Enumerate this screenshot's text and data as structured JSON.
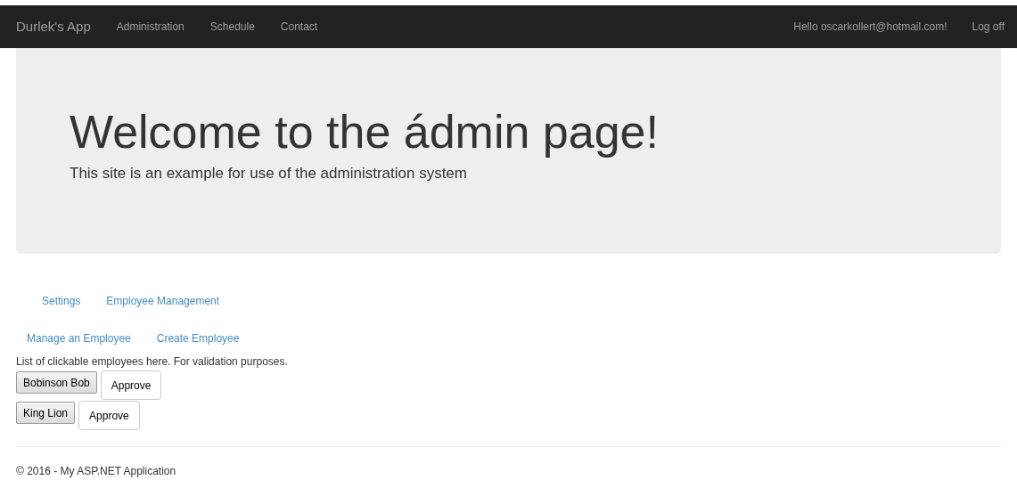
{
  "navbar": {
    "brand": "Durlek's App",
    "links": [
      "Administration",
      "Schedule",
      "Contact"
    ],
    "greeting": "Hello oscarkollert@hotmail.com!",
    "logoff": "Log off"
  },
  "jumbotron": {
    "title": "Welcome to the ádmin page!",
    "lead": "This site is an example for use of the administration system"
  },
  "tabs": [
    "Settings",
    "Employee Management"
  ],
  "subtabs": [
    "Manage an Employee",
    "Create Employee"
  ],
  "note": "List of clickable employees here. For validation purposes.",
  "employees": [
    {
      "name": "Bobinson Bob",
      "action": "Approve"
    },
    {
      "name": "King Lion",
      "action": "Approve"
    }
  ],
  "footer": "© 2016 - My ASP.NET Application"
}
